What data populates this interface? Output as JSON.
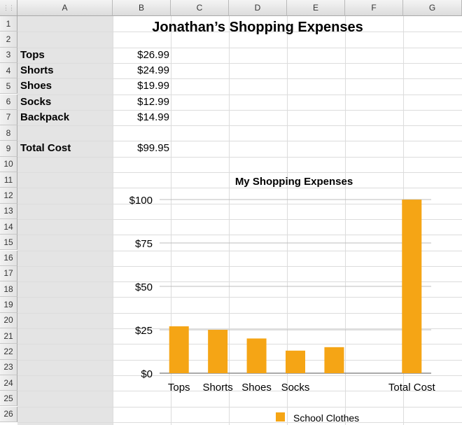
{
  "sheet": {
    "corner_icon": "select-all-icon",
    "columns": [
      "A",
      "B",
      "C",
      "D",
      "E",
      "F",
      "G"
    ],
    "rows": [
      "1",
      "2",
      "3",
      "4",
      "5",
      "6",
      "7",
      "8",
      "9",
      "10",
      "11",
      "12",
      "13",
      "14",
      "15",
      "16",
      "17",
      "18",
      "19",
      "20",
      "21",
      "22",
      "23",
      "24",
      "25",
      "26"
    ],
    "title": "Jonathan’s Shopping Expenses",
    "items": [
      {
        "label": "Tops",
        "value": "$26.99"
      },
      {
        "label": "Shorts",
        "value": "$24.99"
      },
      {
        "label": "Shoes",
        "value": "$19.99"
      },
      {
        "label": "Socks",
        "value": "$12.99"
      },
      {
        "label": "Backpack",
        "value": "$14.99"
      }
    ],
    "total": {
      "label": "Total Cost",
      "value": "$99.95"
    }
  },
  "chart_data": {
    "type": "bar",
    "title": "My Shopping Expenses",
    "categories": [
      "Tops",
      "Shorts",
      "Shoes",
      "Socks",
      "",
      "",
      "Total Cost"
    ],
    "series": [
      {
        "name": "School Clothes",
        "values": [
          26.99,
          24.99,
          19.99,
          12.99,
          14.99,
          null,
          99.95
        ],
        "color": "#f5a515"
      }
    ],
    "yticks": [
      "$0",
      "$25",
      "$50",
      "$75",
      "$100"
    ],
    "ylim": [
      0,
      100
    ],
    "grid": true,
    "legend_position": "bottom"
  }
}
